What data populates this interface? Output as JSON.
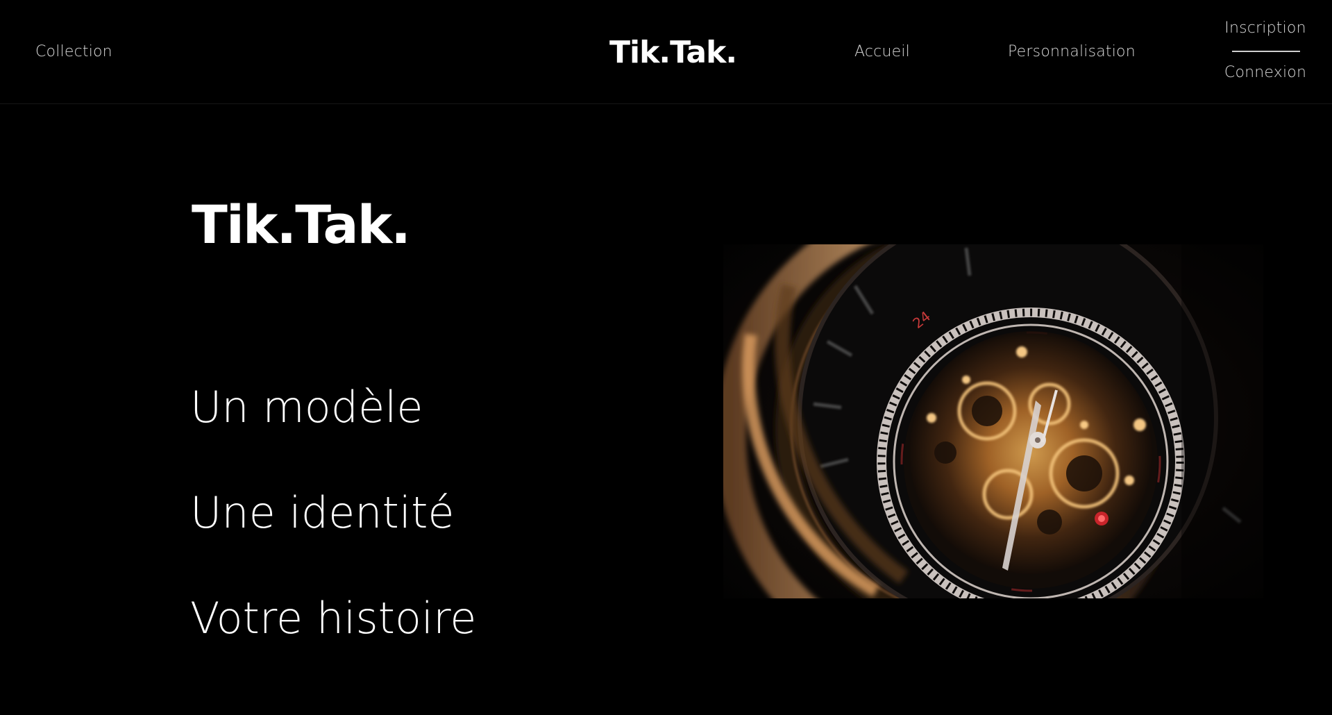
{
  "header": {
    "nav_left": "Collection",
    "logo": "Tik.Tak.",
    "nav_accueil": "Accueil",
    "nav_personnalisation": "Personnalisation",
    "auth": {
      "inscription": "Inscription",
      "connexion": "Connexion"
    }
  },
  "hero": {
    "title": "Tik.Tak.",
    "taglines": [
      "Un modèle",
      "Une identité",
      "Votre histoire"
    ],
    "image": {
      "subject": "skeleton-watch-photo",
      "dial_marker": "24"
    }
  },
  "colors": {
    "background": "#000000",
    "text": "#ffffff",
    "nav_text": "#d9d9d9",
    "bronze": "#b5793a",
    "gold": "#e0a34a"
  }
}
